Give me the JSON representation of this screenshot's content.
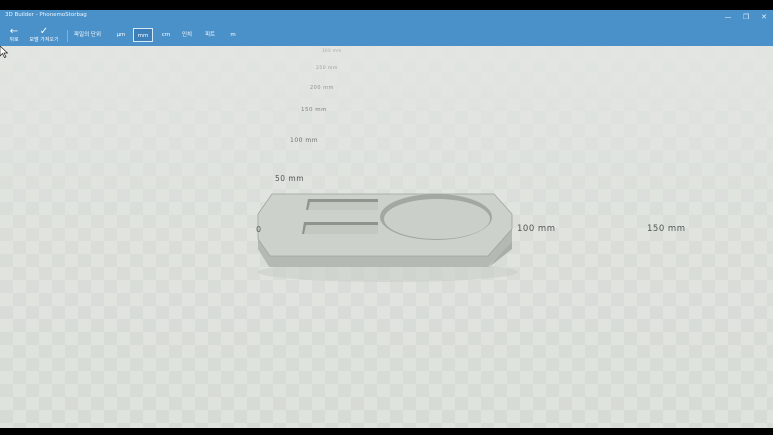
{
  "window": {
    "title": "3D Builder - PhonemoStorbag",
    "minimize_glyph": "—",
    "maximize_glyph": "❐",
    "close_glyph": "✕"
  },
  "toolbar": {
    "back": {
      "icon": "back-arrow-icon",
      "glyph": "←",
      "label": "뒤로"
    },
    "apply": {
      "icon": "check-icon",
      "glyph": "✓",
      "label": "모델 가져오기"
    },
    "unit_label": "파일의 단위",
    "units": [
      {
        "label": "μm",
        "selected": false
      },
      {
        "label": "mm",
        "selected": true
      },
      {
        "label": "cm",
        "selected": false
      },
      {
        "label": "인치",
        "selected": false
      },
      {
        "label": "피트",
        "selected": false
      },
      {
        "label": "m",
        "selected": false
      }
    ]
  },
  "viewport": {
    "y_rulers": [
      "50 mm",
      "100 mm",
      "150 mm",
      "200 mm",
      "250 mm",
      "300 mm"
    ],
    "x_rulers": [
      "0",
      "100 mm",
      "150 mm"
    ],
    "colors": {
      "floor": "#dfe3de",
      "checker": "#d6dad5",
      "model_top": "#cdd1cb",
      "model_side": "#aab0a9",
      "model_recess": "#8e948d"
    }
  }
}
